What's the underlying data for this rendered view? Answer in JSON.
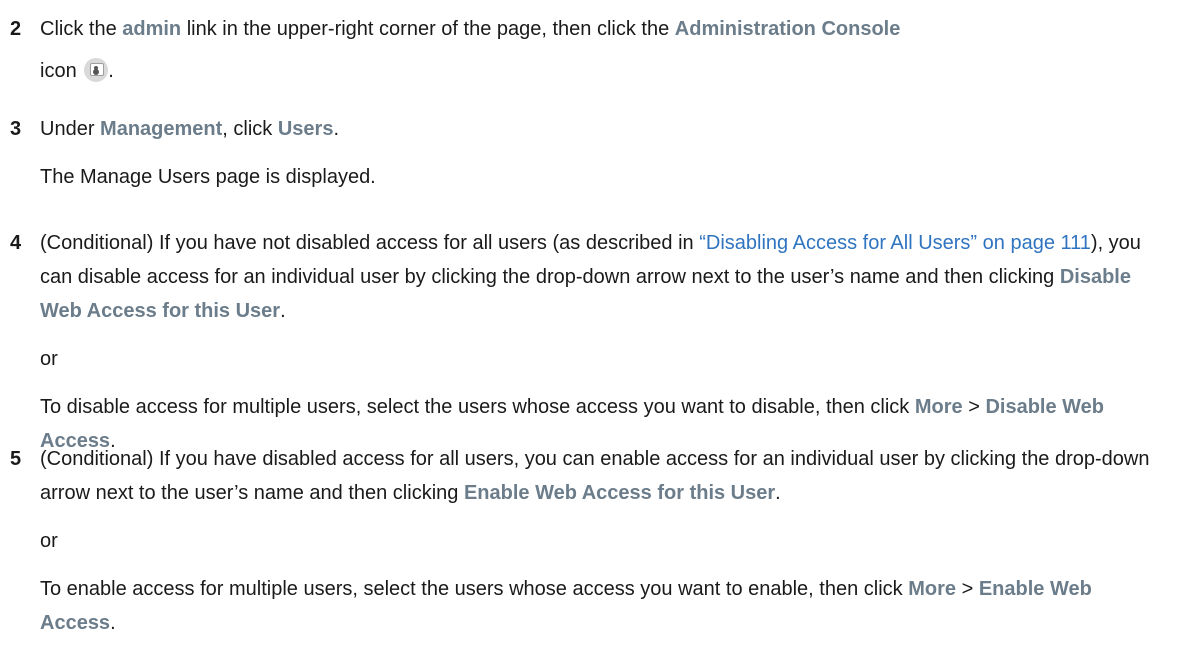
{
  "steps": [
    {
      "number": "2",
      "line1_pre": "Click the ",
      "link_admin": "admin",
      "line1_mid": " link in the upper-right corner of the page, then click the ",
      "admin_console": "Administration Console",
      "line2_pre": "icon",
      "icon": "administration-console-icon",
      "line2_post": "."
    },
    {
      "number": "3",
      "pre": "Under ",
      "management": "Management",
      "mid": ", click ",
      "users": "Users",
      "post": ".",
      "result": "The Manage Users page is displayed."
    },
    {
      "number": "4",
      "pre": "(Conditional) If you have not disabled access for all users (as described in ",
      "xref": "“Disabling Access for All Users” on page 111",
      "mid": "), you can disable access for an individual user by clicking the drop-down arrow next to the user’s name and then clicking ",
      "action": "Disable Web Access for this User",
      "post": ".",
      "or": "or",
      "alt_pre": "To disable access for multiple users, select the users whose access you want to disable, then click ",
      "more": "More",
      "sep": " > ",
      "alt_action": "Disable Web Access",
      "alt_post": "."
    },
    {
      "number": "5",
      "pre": "(Conditional) If you have disabled access for all users, you can enable access for an individual user by clicking the drop-down arrow next to the user’s name and then clicking ",
      "action": "Enable Web Access for this User",
      "post": ".",
      "or": "or",
      "alt_pre": "To enable access for multiple users, select the users whose access you want to enable, then click ",
      "more": "More",
      "sep": " > ",
      "alt_action": "Enable Web Access",
      "alt_post": "."
    }
  ],
  "colors": {
    "ui_term": "#6b7c8a",
    "xref": "#2f74c0",
    "text": "#1a1a1a"
  }
}
